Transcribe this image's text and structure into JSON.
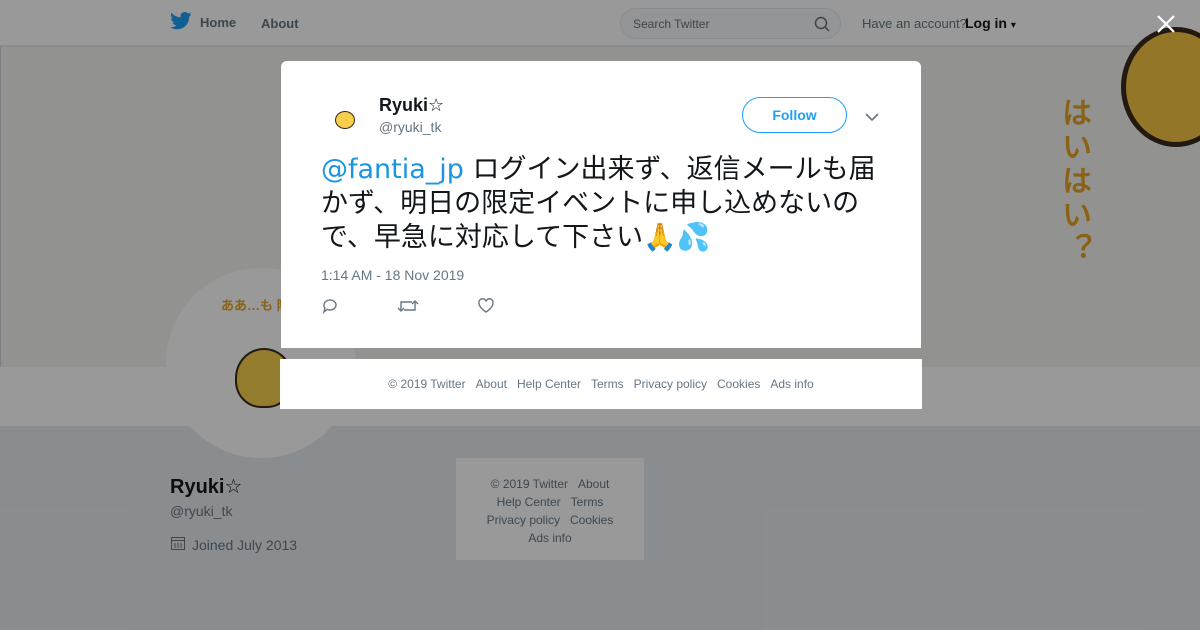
{
  "nav": {
    "home_label": "Home",
    "about_label": "About",
    "search_placeholder": "Search Twitter",
    "account_prompt": "Have an account?",
    "login_label": "Log in"
  },
  "profile": {
    "name": "Ryuki☆",
    "handle": "@ryuki_tk",
    "joined": "Joined July 2013",
    "banner_text": "はいはい？",
    "avatar_text": "ああ…も 限"
  },
  "side_footer": {
    "links": [
      "© 2019 Twitter",
      "About",
      "Help Center",
      "Terms",
      "Privacy policy",
      "Cookies",
      "Ads info"
    ]
  },
  "tweet": {
    "name": "Ryuki☆",
    "handle": "@ryuki_tk",
    "follow_label": "Follow",
    "mention": "@fantia_jp",
    "text": " ログイン出来ず、返信メールも届かず、明日の限定イベントに申し込めないので、早急に対応して下さい",
    "emoji": "🙏💦",
    "timestamp": "1:14 AM - 18 Nov 2019"
  },
  "modal_footer": {
    "links": [
      "© 2019 Twitter",
      "About",
      "Help Center",
      "Terms",
      "Privacy policy",
      "Cookies",
      "Ads info"
    ]
  },
  "colors": {
    "accent": "#1da1f2",
    "mention": "#1b95e0",
    "muted": "#657786"
  }
}
